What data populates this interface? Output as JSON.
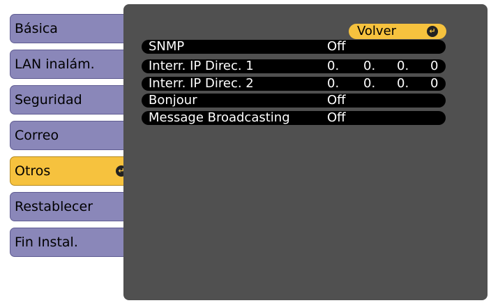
{
  "sidebar": {
    "items": [
      {
        "label": "Básica"
      },
      {
        "label": "LAN inalám."
      },
      {
        "label": "Seguridad"
      },
      {
        "label": "Correo"
      },
      {
        "label": "Otros"
      },
      {
        "label": "Restablecer"
      },
      {
        "label": "Fin Instal."
      }
    ],
    "selected_index": 4
  },
  "panel": {
    "back_label": "Volver",
    "rows": [
      {
        "label": "SNMP",
        "value": "Off"
      },
      {
        "label": "Interr. IP Direc. 1",
        "octets": [
          "0.",
          "0.",
          "0.",
          "0"
        ]
      },
      {
        "label": "Interr. IP Direc. 2",
        "octets": [
          "0.",
          "0.",
          "0.",
          "0"
        ]
      },
      {
        "label": "Bonjour",
        "value": "Off"
      },
      {
        "label": "Message Broadcasting",
        "value": "Off"
      }
    ]
  },
  "colors": {
    "selected": "#f6c23e",
    "tab": "#8a87b9",
    "panel": "#505050",
    "row": "#000000"
  },
  "icons": {
    "enter": "enter-icon"
  }
}
